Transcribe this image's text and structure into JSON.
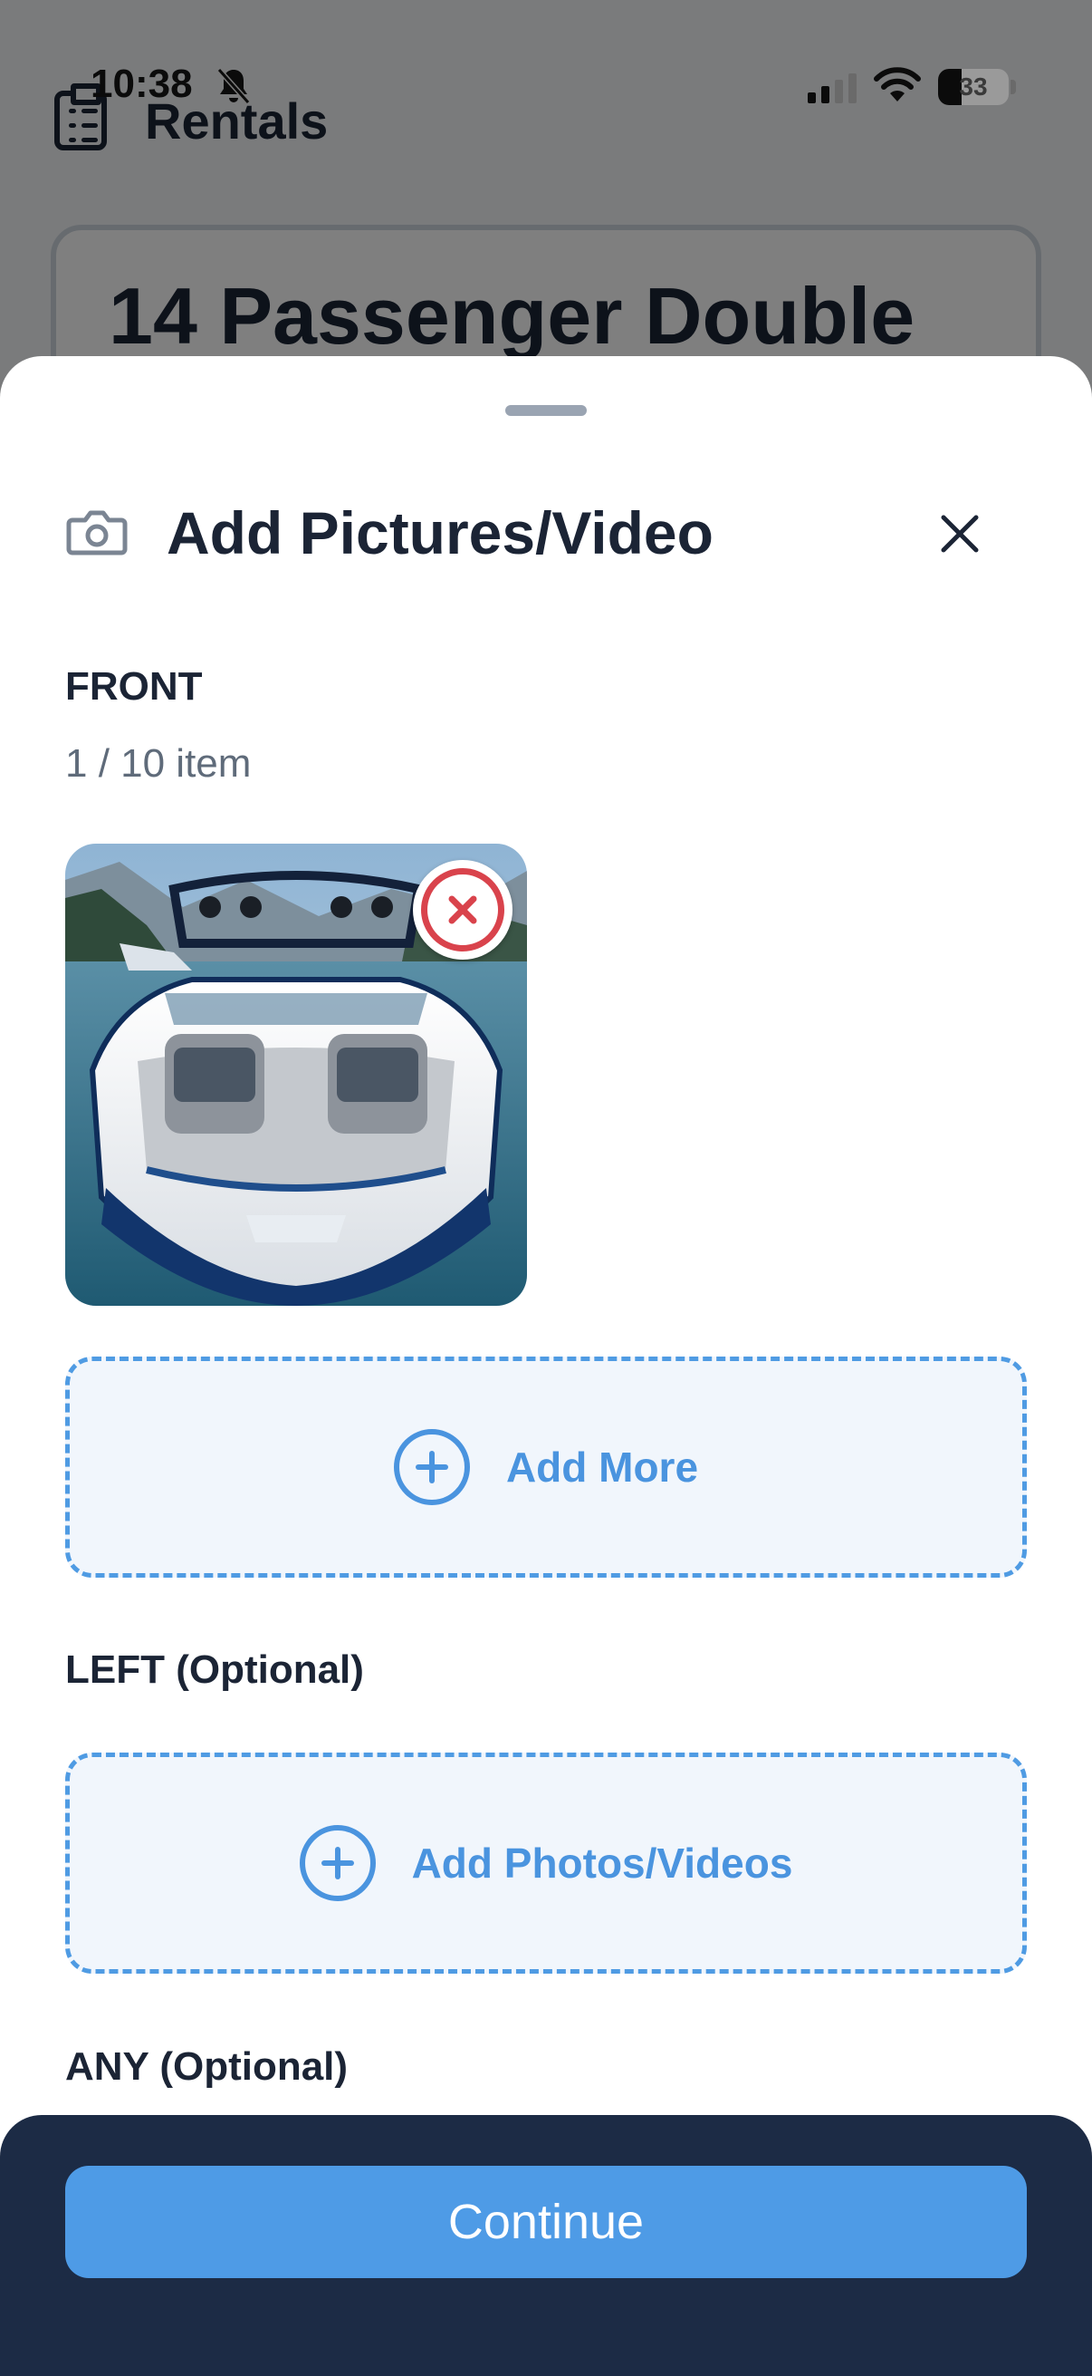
{
  "status_bar": {
    "time": "10:38",
    "battery_percent": "33",
    "icons": [
      "bell-slash-icon",
      "cellular-signal-icon",
      "wifi-icon",
      "battery-icon"
    ]
  },
  "background": {
    "header_title": "Rentals",
    "card_title": "14 Passenger Double"
  },
  "sheet": {
    "title": "Add Pictures/Video",
    "icons": [
      "camera-icon",
      "close-icon"
    ],
    "front": {
      "label": "FRONT",
      "count": "1 / 10 item",
      "thumbnail_alt": "Photo of a blue and white Malibu boat on a lake",
      "add_more_label": "Add More"
    },
    "left": {
      "label": "LEFT (Optional)",
      "add_label": "Add Photos/Videos"
    },
    "any": {
      "label": "ANY (Optional)"
    }
  },
  "footer": {
    "continue_label": "Continue"
  },
  "colors": {
    "primary_text": "#1b2435",
    "accent_blue": "#4a94df",
    "button_blue": "#4e9be6",
    "footer_bg": "#1c2b45",
    "remove_red": "#d9434c",
    "dropzone_bg": "#f1f6fc"
  }
}
